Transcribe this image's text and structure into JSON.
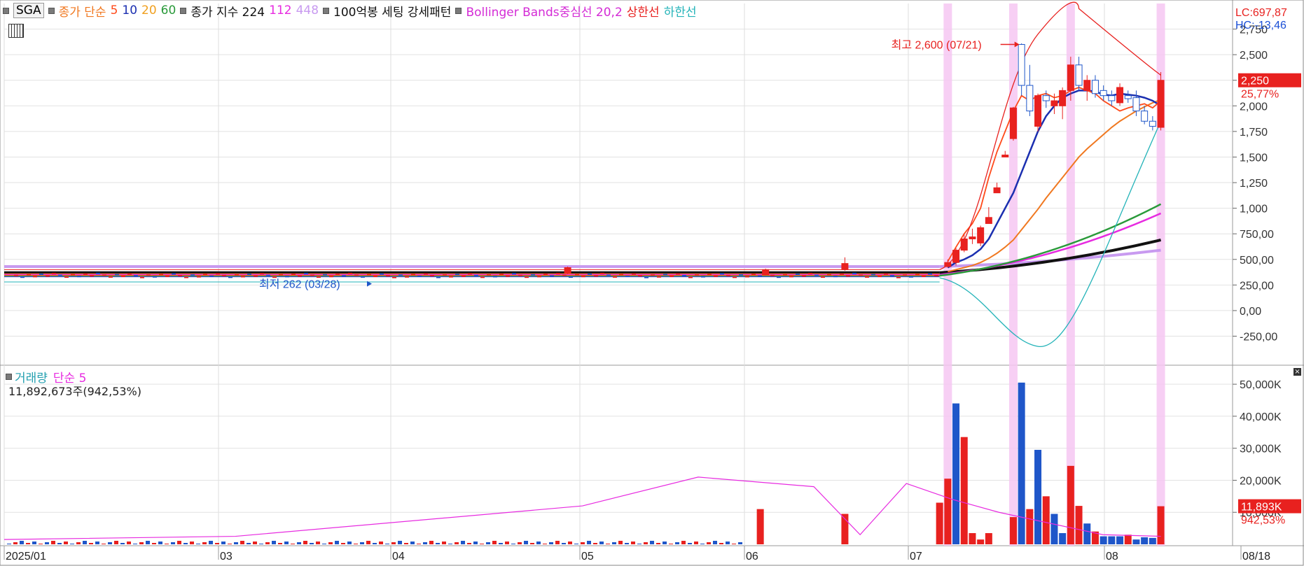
{
  "header": {
    "symbol": "SGA",
    "ma_label": "종가 단순",
    "ma_periods": [
      "5",
      "10",
      "20",
      "60"
    ],
    "exp_label": "종가 지수 224",
    "exp_periods": [
      "112",
      "448"
    ],
    "setting_label": "100억봉 세팅 강세패턴",
    "bb_label": "Bollinger Bands중심선 20,2",
    "upper_label": "상한선",
    "lower_label": "하한선",
    "lc": "LC:697,87",
    "hc": "HC:-13,46"
  },
  "price_panel": {
    "high_annotation": "최고 2,600 (07/21)",
    "low_annotation": "최저 262 (03/28)",
    "last_price": "2,250",
    "last_change": "25,77%"
  },
  "volume_panel": {
    "label": "거래량",
    "ma_label": "단순 5",
    "summary": "11,892,673주(942,53%)",
    "last_volume": "11,893K",
    "last_change": "942,53%"
  },
  "x_axis_labels": [
    "2025/01",
    "03",
    "04",
    "05",
    "06",
    "07",
    "08",
    "08/18"
  ],
  "colors": {
    "up": "#e8211f",
    "down": "#1f56c9",
    "ma5": "#ff4a1a",
    "ma10": "#1b2fb0",
    "ma20": "#f07820",
    "ma60": "#2a9a3a",
    "ema224": "#111111",
    "ema112": "#e72be0",
    "ema448": "#c89af0",
    "bb_upper": "#e8211f",
    "bb_lower": "#23b3b8",
    "highlight": "#f6c7f2"
  },
  "chart_data": [
    {
      "type": "candlestick",
      "title": "SGA",
      "y_ticks": [
        -250,
        0,
        250,
        500,
        750,
        1000,
        1250,
        1500,
        1750,
        2000,
        2250,
        2500,
        2750
      ],
      "ylim": [
        -520,
        3000
      ],
      "baseline_price": 340,
      "pre_rally_candles": [
        {
          "date": "04/30",
          "open": 365,
          "high": 430,
          "low": 355,
          "close": 420
        },
        {
          "date": "06/05",
          "open": 350,
          "high": 410,
          "low": 345,
          "close": 400
        },
        {
          "date": "06/20",
          "open": 400,
          "high": 520,
          "low": 390,
          "close": 460
        }
      ],
      "candles": [
        {
          "date": "07/08",
          "open": 430,
          "high": 500,
          "low": 420,
          "close": 470
        },
        {
          "date": "07/09",
          "open": 470,
          "high": 610,
          "low": 440,
          "close": 590
        },
        {
          "date": "07/10",
          "open": 590,
          "high": 750,
          "low": 570,
          "close": 700
        },
        {
          "date": "07/11",
          "open": 700,
          "high": 800,
          "low": 650,
          "close": 720
        },
        {
          "date": "07/14",
          "open": 660,
          "high": 830,
          "low": 630,
          "close": 810
        },
        {
          "date": "07/15",
          "open": 850,
          "high": 1010,
          "low": 850,
          "close": 910
        },
        {
          "date": "07/16",
          "open": 1150,
          "high": 1250,
          "low": 1150,
          "close": 1200
        },
        {
          "date": "07/17",
          "open": 1500,
          "high": 1560,
          "low": 1500,
          "close": 1520
        },
        {
          "date": "07/18",
          "open": 1680,
          "high": 1990,
          "low": 1660,
          "close": 1980
        },
        {
          "date": "07/21",
          "open": 2600,
          "high": 2610,
          "low": 2100,
          "close": 2200
        },
        {
          "date": "07/22",
          "open": 2200,
          "high": 2400,
          "low": 1900,
          "close": 1950
        },
        {
          "date": "07/23",
          "open": 1800,
          "high": 2120,
          "low": 1750,
          "close": 2100
        },
        {
          "date": "07/24",
          "open": 2100,
          "high": 2150,
          "low": 1980,
          "close": 2050
        },
        {
          "date": "07/25",
          "open": 2000,
          "high": 2120,
          "low": 1920,
          "close": 2050
        },
        {
          "date": "07/28",
          "open": 2000,
          "high": 2180,
          "low": 1870,
          "close": 2150
        },
        {
          "date": "07/29",
          "open": 2150,
          "high": 2480,
          "low": 2050,
          "close": 2400
        },
        {
          "date": "07/30",
          "open": 2400,
          "high": 2480,
          "low": 2150,
          "close": 2200
        },
        {
          "date": "07/31",
          "open": 2150,
          "high": 2300,
          "low": 2050,
          "close": 2250
        },
        {
          "date": "08/01",
          "open": 2250,
          "high": 2300,
          "low": 2080,
          "close": 2120
        },
        {
          "date": "08/04",
          "open": 2150,
          "high": 2200,
          "low": 2050,
          "close": 2100
        },
        {
          "date": "08/05",
          "open": 2100,
          "high": 2150,
          "low": 2000,
          "close": 2050
        },
        {
          "date": "08/06",
          "open": 2030,
          "high": 2220,
          "low": 2000,
          "close": 2180
        },
        {
          "date": "08/07",
          "open": 2100,
          "high": 2150,
          "low": 2030,
          "close": 2070
        },
        {
          "date": "08/08",
          "open": 2080,
          "high": 2150,
          "low": 1900,
          "close": 1950
        },
        {
          "date": "08/11",
          "open": 1950,
          "high": 2000,
          "low": 1820,
          "close": 1850
        },
        {
          "date": "08/12",
          "open": 1850,
          "high": 1900,
          "low": 1760,
          "close": 1800
        },
        {
          "date": "08/13",
          "open": 1790,
          "high": 2330,
          "low": 1760,
          "close": 2250
        }
      ],
      "ma5_tail": [
        480,
        620,
        750,
        850,
        1000,
        1300,
        1550,
        1750,
        1950,
        2100,
        2050,
        2100,
        2120,
        2080,
        2100,
        2150,
        2180,
        2150,
        2120,
        2050,
        2000,
        1950,
        1980,
        2000,
        2020,
        1980,
        2050
      ],
      "ma10_tail": [
        420,
        470,
        500,
        540,
        600,
        700,
        850,
        1000,
        1150,
        1350,
        1550,
        1750,
        1900,
        2000,
        2080,
        2120,
        2150,
        2150,
        2140,
        2110,
        2100,
        2120,
        2110,
        2100,
        2080,
        2050,
        2000
      ],
      "ma20_tail": [
        380,
        400,
        420,
        440,
        470,
        510,
        560,
        620,
        690,
        790,
        890,
        990,
        1100,
        1200,
        1300,
        1400,
        1500,
        1580,
        1650,
        1720,
        1790,
        1850,
        1900,
        1950,
        1990,
        2030,
        2060
      ],
      "ma60_end": 1040,
      "ema112_end": 950,
      "ema224_end": 690,
      "ema448_end": 590,
      "bb_upper_peak": 2950,
      "bb_lower_trough": -350,
      "highlight_dates": [
        "07/08",
        "07/18",
        "07/29",
        "08/13"
      ]
    },
    {
      "type": "bar",
      "title": "거래량",
      "unit": "K",
      "y_ticks": [
        10000,
        20000,
        30000,
        40000,
        50000
      ],
      "ylim": [
        0,
        52000
      ],
      "volumes": [
        {
          "date": "06/04",
          "value": 11000,
          "up": true
        },
        {
          "date": "06/20",
          "value": 9500,
          "up": true
        },
        {
          "date": "07/07",
          "value": 13000,
          "up": true
        },
        {
          "date": "07/08",
          "value": 20500,
          "up": true
        },
        {
          "date": "07/09",
          "value": 44000,
          "up": false
        },
        {
          "date": "07/10",
          "value": 33500,
          "up": true
        },
        {
          "date": "07/11",
          "value": 3500,
          "up": true
        },
        {
          "date": "07/14",
          "value": 1500,
          "up": true
        },
        {
          "date": "07/15",
          "value": 3500,
          "up": true
        },
        {
          "date": "07/18",
          "value": 8500,
          "up": true
        },
        {
          "date": "07/21",
          "value": 50500,
          "up": false
        },
        {
          "date": "07/22",
          "value": 11000,
          "up": true
        },
        {
          "date": "07/23",
          "value": 29500,
          "up": false
        },
        {
          "date": "07/24",
          "value": 15000,
          "up": true
        },
        {
          "date": "07/25",
          "value": 9500,
          "up": false
        },
        {
          "date": "07/28",
          "value": 3500,
          "up": false
        },
        {
          "date": "07/29",
          "value": 24500,
          "up": true
        },
        {
          "date": "07/30",
          "value": 12000,
          "up": true
        },
        {
          "date": "07/31",
          "value": 6500,
          "up": false
        },
        {
          "date": "08/01",
          "value": 4000,
          "up": true
        },
        {
          "date": "08/04",
          "value": 2500,
          "up": false
        },
        {
          "date": "08/05",
          "value": 2500,
          "up": false
        },
        {
          "date": "08/06",
          "value": 2500,
          "up": false
        },
        {
          "date": "08/07",
          "value": 3000,
          "up": true
        },
        {
          "date": "08/08",
          "value": 1500,
          "up": false
        },
        {
          "date": "08/11",
          "value": 2200,
          "up": false
        },
        {
          "date": "08/12",
          "value": 2000,
          "up": false
        },
        {
          "date": "08/13",
          "value": 11893,
          "up": true
        }
      ],
      "ma5_points": [
        [
          0,
          1500
        ],
        [
          20,
          2500
        ],
        [
          50,
          12000
        ],
        [
          60,
          21000
        ],
        [
          70,
          18000
        ],
        [
          74,
          3000
        ],
        [
          78,
          19000
        ],
        [
          82,
          14000
        ],
        [
          86,
          10000
        ],
        [
          95,
          3000
        ],
        [
          100,
          2500
        ]
      ]
    }
  ]
}
